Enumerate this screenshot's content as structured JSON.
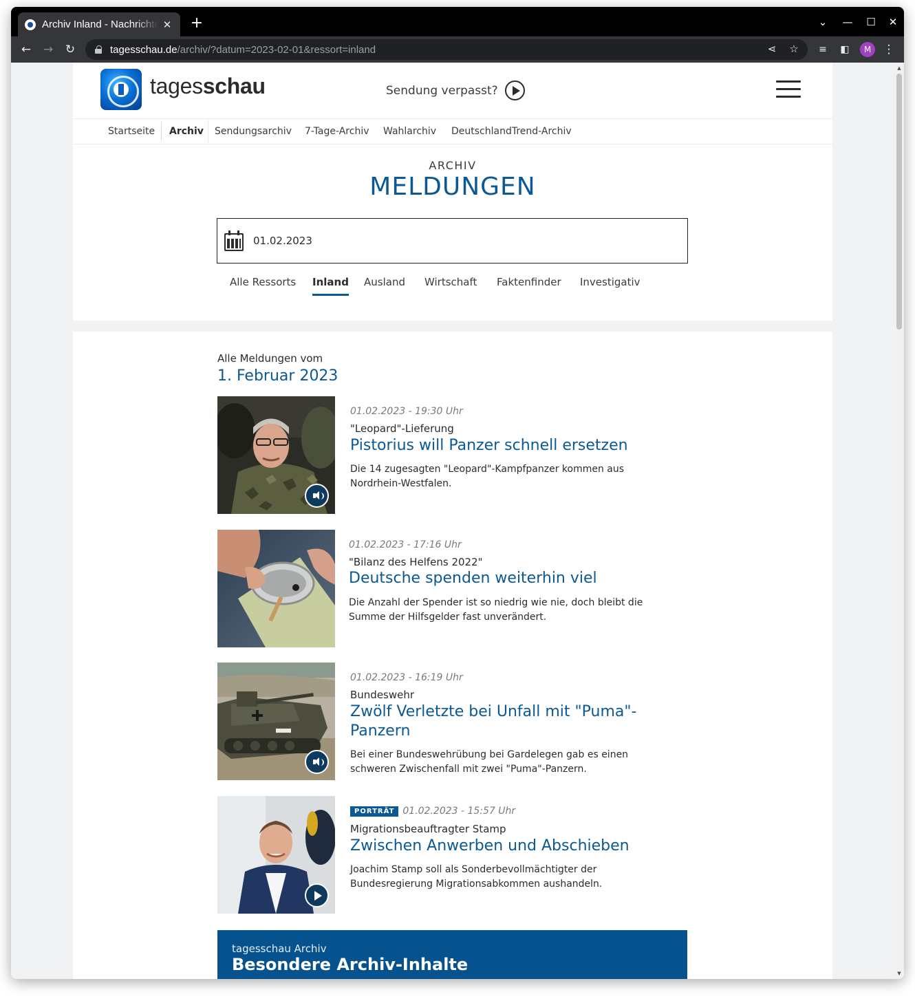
{
  "browser": {
    "tab_title": "Archiv Inland - Nachrichten",
    "url_host": "tagesschau.de",
    "url_path": "/archiv/?datum=2023-02-01&ressort=inland",
    "profile_initial": "M"
  },
  "site": {
    "wordmark_light": "tages",
    "wordmark_bold": "schau",
    "sendung_label": "Sendung verpasst?",
    "subnav": [
      "Startseite",
      "Archiv",
      "Sendungsarchiv",
      "7-Tage-Archiv",
      "Wahlarchiv",
      "DeutschlandTrend-Archiv"
    ],
    "subnav_active": "Archiv"
  },
  "archive": {
    "kicker": "ARCHIV",
    "title": "MELDUNGEN",
    "date_value": "01.02.2023",
    "ressorts": [
      "Alle Ressorts",
      "Inland",
      "Ausland",
      "Wirtschaft",
      "Faktenfinder",
      "Investigativ"
    ],
    "ressort_active": "Inland"
  },
  "list": {
    "head_small": "Alle Meldungen vom",
    "head_date": "1. Februar 2023",
    "items": [
      {
        "meta": "01.02.2023 - 19:30 Uhr",
        "topline": "\"Leopard\"-Lieferung",
        "headline": "Pistorius will Panzer schnell ersetzen",
        "teaser": "Die 14 zugesagten \"Leopard\"-Kampfpanzer kommen aus Nordrhein-Westfalen.",
        "media": "audio"
      },
      {
        "meta": "01.02.2023 - 17:16 Uhr",
        "topline": "\"Bilanz des Helfens 2022\"",
        "headline": "Deutsche spenden weiterhin viel",
        "teaser": "Die Anzahl der Spender ist so niedrig wie nie, doch bleibt die Summe der Hilfsgelder fast unverändert.",
        "media": "none"
      },
      {
        "meta": "01.02.2023 - 16:19 Uhr",
        "topline": "Bundeswehr",
        "headline": "Zwölf Verletzte bei Unfall mit \"Puma\"-Panzern",
        "teaser": "Bei einer Bundeswehrübung bei Gardelegen gab es einen schweren Zwischenfall mit zwei \"Puma\"-Panzern.",
        "media": "audio"
      },
      {
        "badge": "PORTRÄT",
        "meta": "01.02.2023 - 15:57 Uhr",
        "topline": "Migrationsbeauftragter Stamp",
        "headline": "Zwischen Anwerben und Abschieben",
        "teaser": "Joachim Stamp soll als Sonderbevollmächtigter der Bundesregierung Migrationsabkommen aushandeln.",
        "media": "video"
      }
    ]
  },
  "banner": {
    "small": "tagesschau Archiv",
    "big": "Besondere Archiv-Inhalte"
  },
  "colors": {
    "brand_blue": "#0a5996",
    "banner_blue": "#06528f",
    "page_bg": "#f1f2f4"
  }
}
